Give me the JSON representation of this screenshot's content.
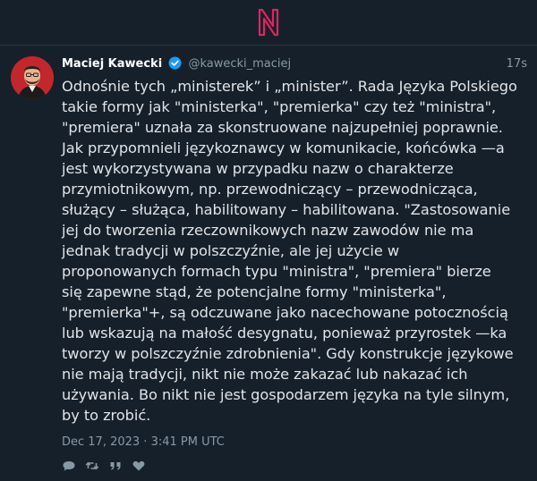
{
  "app": {
    "logo": "N"
  },
  "tweet": {
    "author_name": "Maciej Kawecki",
    "author_handle": "@kawecki_maciej",
    "relative_time": "17s",
    "text": "Odnośnie tych „ministerek” i „minister”. Rada Języka Polskiego\ntakie formy jak \"ministerka\", \"premierka\" czy też \"ministra\",\n\"premiera\" uznała za skonstruowane najzupełniej poprawnie.\nJak przypomnieli językoznawcy w komunikacie, końcówka —a\njest wykorzystywana w przypadku nazw o charakterze\nprzymiotnikowym, np. przewodniczący – przewodnicząca,\nsłużący – służąca, habilitowany – habilitowana. \"Zastosowanie\njej do tworzenia rzeczownikowych nazw zawodów nie ma\njednak tradycji w polszczyźnie, ale jej użycie w\nproponowanych formach typu \"ministra\", \"premiera\" bierze\nsię zapewne stąd, że potencjalne formy \"ministerka\",\n\"premierka\"+, są odczuwane jako nacechowane potocznością\nlub wskazują na małość desygnatu, ponieważ przyrostek —ka\ntworzy w polszczyźnie zdrobnienia\". Gdy konstrukcje językowe\nnie mają tradycji, nikt nie może zakazać lub nakazać ich\nużywania. Bo nikt nie jest gospodarzem języka na tyle silnym,\nby to zrobić.",
    "date": "Dec 17, 2023 · 3:41 PM UTC"
  },
  "icons": {
    "logo": "n-logo-icon",
    "verified": "verified-badge-icon",
    "reply": "reply-icon",
    "retweet": "retweet-icon",
    "quote": "quote-icon",
    "like": "heart-icon"
  },
  "colors": {
    "background": "#15202b",
    "logo": "#e0245e",
    "verified": "#1d9bf0",
    "muted": "#8899a6",
    "avatar_bg": "#c1272d"
  }
}
